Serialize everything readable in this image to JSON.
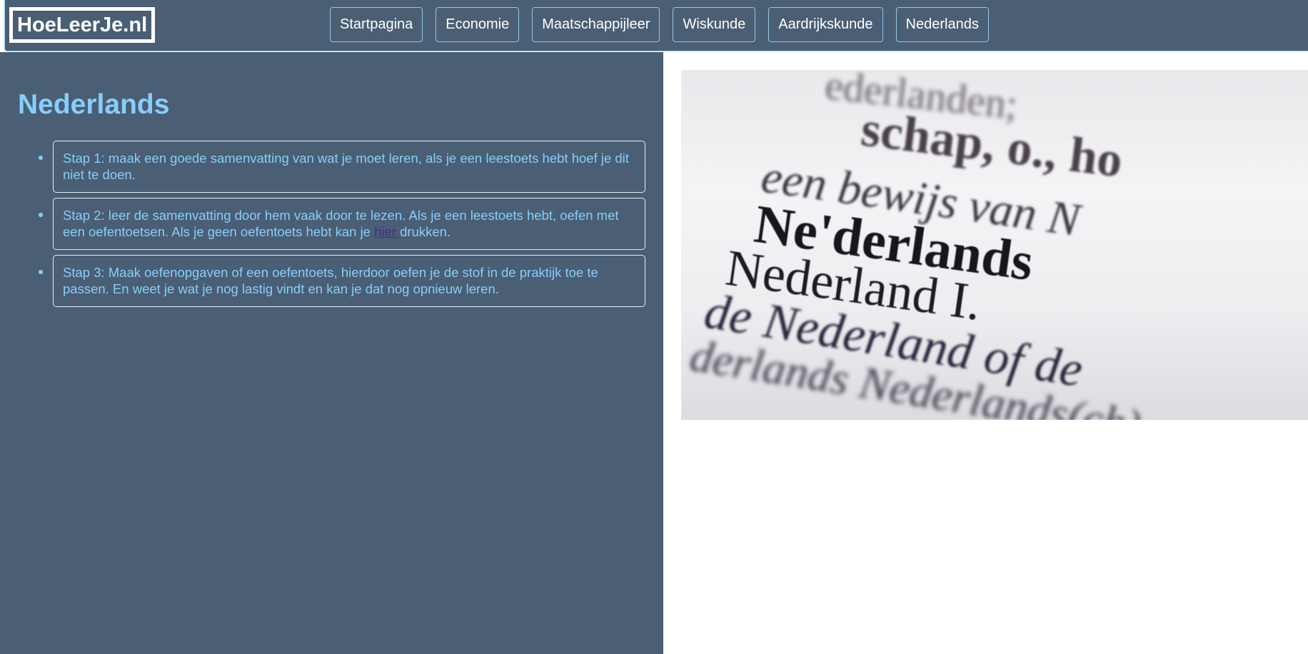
{
  "header": {
    "logo": "HoeLeerJe.nl",
    "nav": [
      {
        "label": "Startpagina"
      },
      {
        "label": "Economie"
      },
      {
        "label": "Maatschappijleer"
      },
      {
        "label": "Wiskunde"
      },
      {
        "label": "Aardrijkskunde"
      },
      {
        "label": "Nederlands"
      }
    ]
  },
  "main": {
    "title": "Nederlands",
    "steps": [
      {
        "text": "Stap 1: maak een goede samenvatting van wat je moet leren, als je een leestoets hebt hoef je dit niet te doen."
      },
      {
        "text_before": "Stap 2: leer de samenvatting door hem vaak door te lezen. Als je een leestoets hebt, oefen met een oefentoetsen. Als je geen oefentoets hebt kan je ",
        "link": "hier ",
        "text_after": "drukken."
      },
      {
        "text": "Stap 3: Maak oefenopgaven of een oefentoets, hierdoor oefen je de stof in de praktijk toe te passen. En weet je wat je nog lastig vindt en kan je dat nog opnieuw leren."
      }
    ]
  },
  "image": {
    "lines": [
      "ederlanden;",
      "schap, o., ho",
      "een bewijs van N",
      "Ne'derlands",
      "Nederland  I.",
      "de Nederland of de",
      "derlands  Nederlands(ch)"
    ]
  },
  "colors": {
    "panel_bg": "#4a5e74",
    "accent": "#87cefa",
    "link": "#4b2a8c"
  }
}
